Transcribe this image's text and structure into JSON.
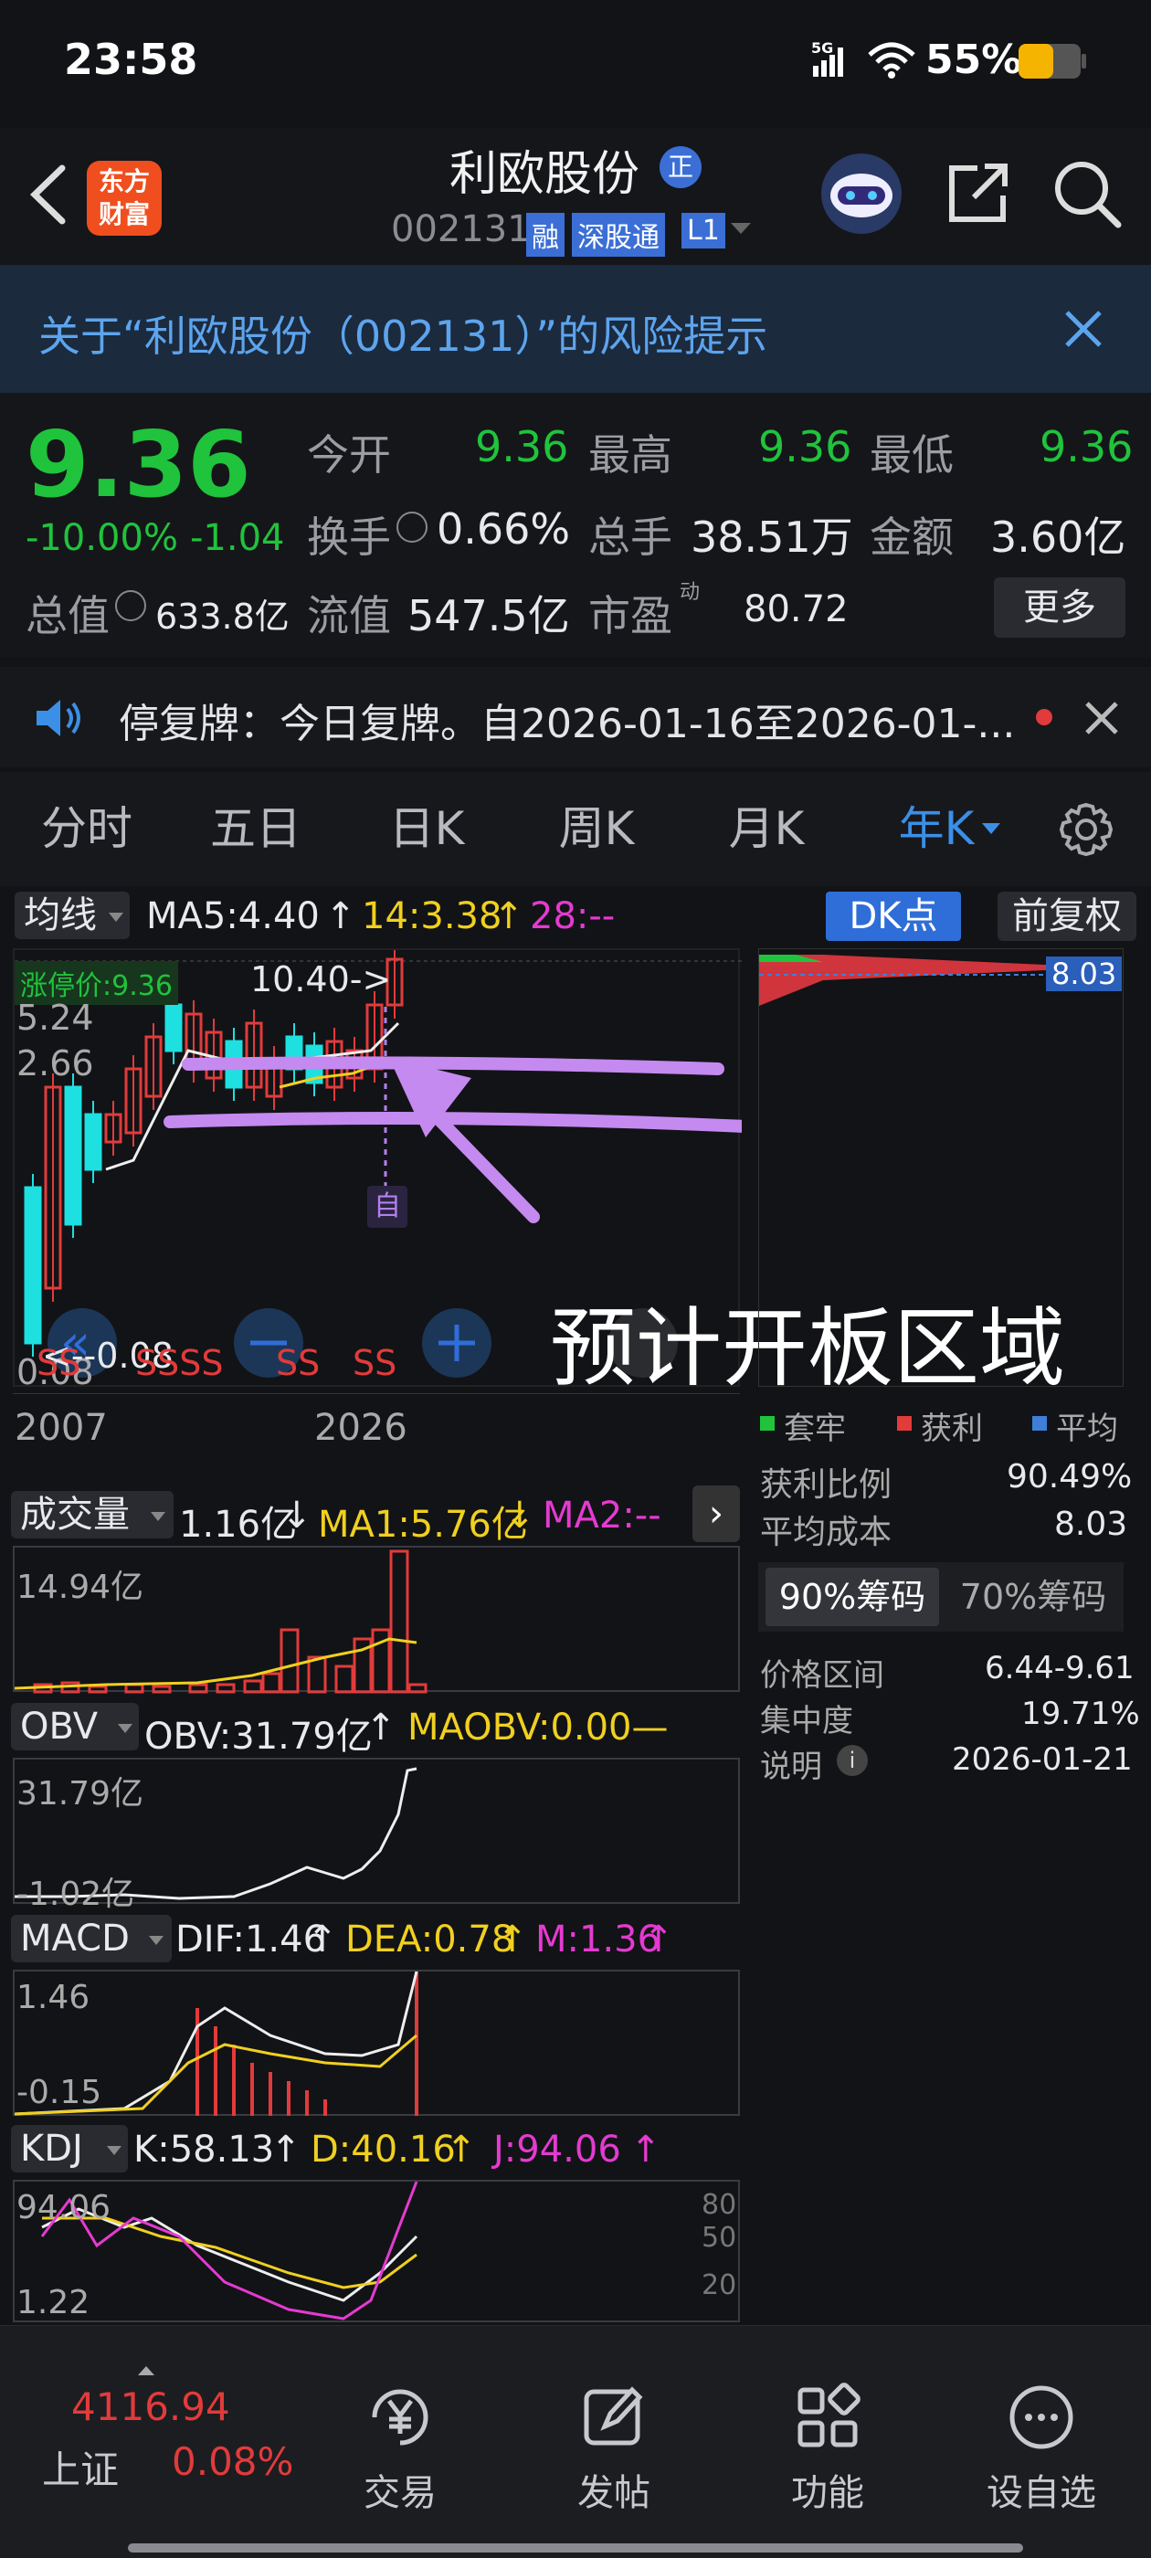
{
  "status": {
    "time": "23:58",
    "network": "5G",
    "battery": "55%"
  },
  "header": {
    "logo_line1": "东方",
    "logo_line2": "财富",
    "stock_name": "利欧股份",
    "name_badge": "正",
    "code": "002131",
    "tags": [
      "融",
      "深股通",
      "L1"
    ]
  },
  "banner": {
    "text": "关于“利欧股份（002131）”的风险提示"
  },
  "quote": {
    "price": "9.36",
    "change_pct": "-10.00%",
    "change": "-1.04",
    "open_label": "今开",
    "open": "9.36",
    "high_label": "最高",
    "high": "9.36",
    "low_label": "最低",
    "low": "9.36",
    "turnover_label": "换手",
    "turnover": "0.66%",
    "volume_label": "总手",
    "volume": "38.51万",
    "amount_label": "金额",
    "amount": "3.60亿",
    "total_value_label": "总值",
    "total_value": "633.8亿",
    "float_value_label": "流值",
    "float_value": "547.5亿",
    "pe_label": "市盈",
    "pe_sup": "动",
    "pe": "80.72",
    "more": "更多"
  },
  "notice": {
    "text": "停复牌：今日复牌。自2026-01-16至2026-01-..."
  },
  "tabs": [
    "分时",
    "五日",
    "日K",
    "周K",
    "月K",
    "年K"
  ],
  "kline": {
    "ma_select": "均线",
    "ma5": "MA5:4.40",
    "ma5_arrow": "↑",
    "ma14": "14:3.38",
    "ma14_arrow": "↑",
    "ma28": "28:--",
    "dk": "DK点",
    "adjust": "前复权",
    "price_tag": "涨停价:9.36",
    "max_label": "10.40->",
    "min_label": "<--0.08",
    "y_labels": [
      "5.24",
      "2.66",
      "0.08"
    ],
    "x_start": "2007",
    "x_end": "2026",
    "marker": "自",
    "annotation": "预计开板区域",
    "ss": [
      "SS",
      "SSSS",
      "SS",
      "SS"
    ]
  },
  "chip": {
    "cost_tag": "8.03",
    "legend": [
      "套牢",
      "获利",
      "平均"
    ],
    "legend_colors": [
      "#20c33c",
      "#e23b3b",
      "#3f7fd8"
    ],
    "rows": [
      {
        "label": "获利比例",
        "value": "90.49%"
      },
      {
        "label": "平均成本",
        "value": "8.03"
      }
    ],
    "tab_active": "90%筹码",
    "tab_other": "70%筹码",
    "rows2": [
      {
        "label": "价格区间",
        "value": "6.44-9.61"
      },
      {
        "label": "集中度",
        "value": "19.71%"
      },
      {
        "label": "说明",
        "value": "2026-01-21"
      }
    ]
  },
  "volume": {
    "select": "成交量",
    "vol": "1.16亿",
    "vol_arrow": "↓",
    "ma1": "MA1:5.76亿",
    "ma1_arrow": "↓",
    "ma2": "MA2:--",
    "y_top": "14.94亿"
  },
  "obv": {
    "select": "OBV",
    "obv": "OBV:31.79亿",
    "obv_arrow": "↑",
    "maobv": "MAOBV:0.00—",
    "y_top": "31.79亿",
    "y_bot": "-1.02亿"
  },
  "macd": {
    "select": "MACD",
    "dif": "DIF:1.46",
    "dif_arrow": "↑",
    "dea": "DEA:0.78",
    "dea_arrow": "↑",
    "m": "M:1.36",
    "m_arrow": "↑",
    "y_top": "1.46",
    "y_bot": "-0.15"
  },
  "kdj": {
    "select": "KDJ",
    "k": "K:58.13",
    "k_arrow": "↑",
    "d": "D:40.16",
    "d_arrow": "↑",
    "j": "J:94.06",
    "j_arrow": "↑",
    "y_top": "94.06",
    "y_bot": "1.22",
    "r80": "80",
    "r50": "50",
    "r20": "20"
  },
  "bottom": {
    "index_value": "4116.94",
    "index_name": "上证",
    "index_change": "0.08%",
    "items": [
      "交易",
      "发帖",
      "功能",
      "设自选"
    ]
  }
}
